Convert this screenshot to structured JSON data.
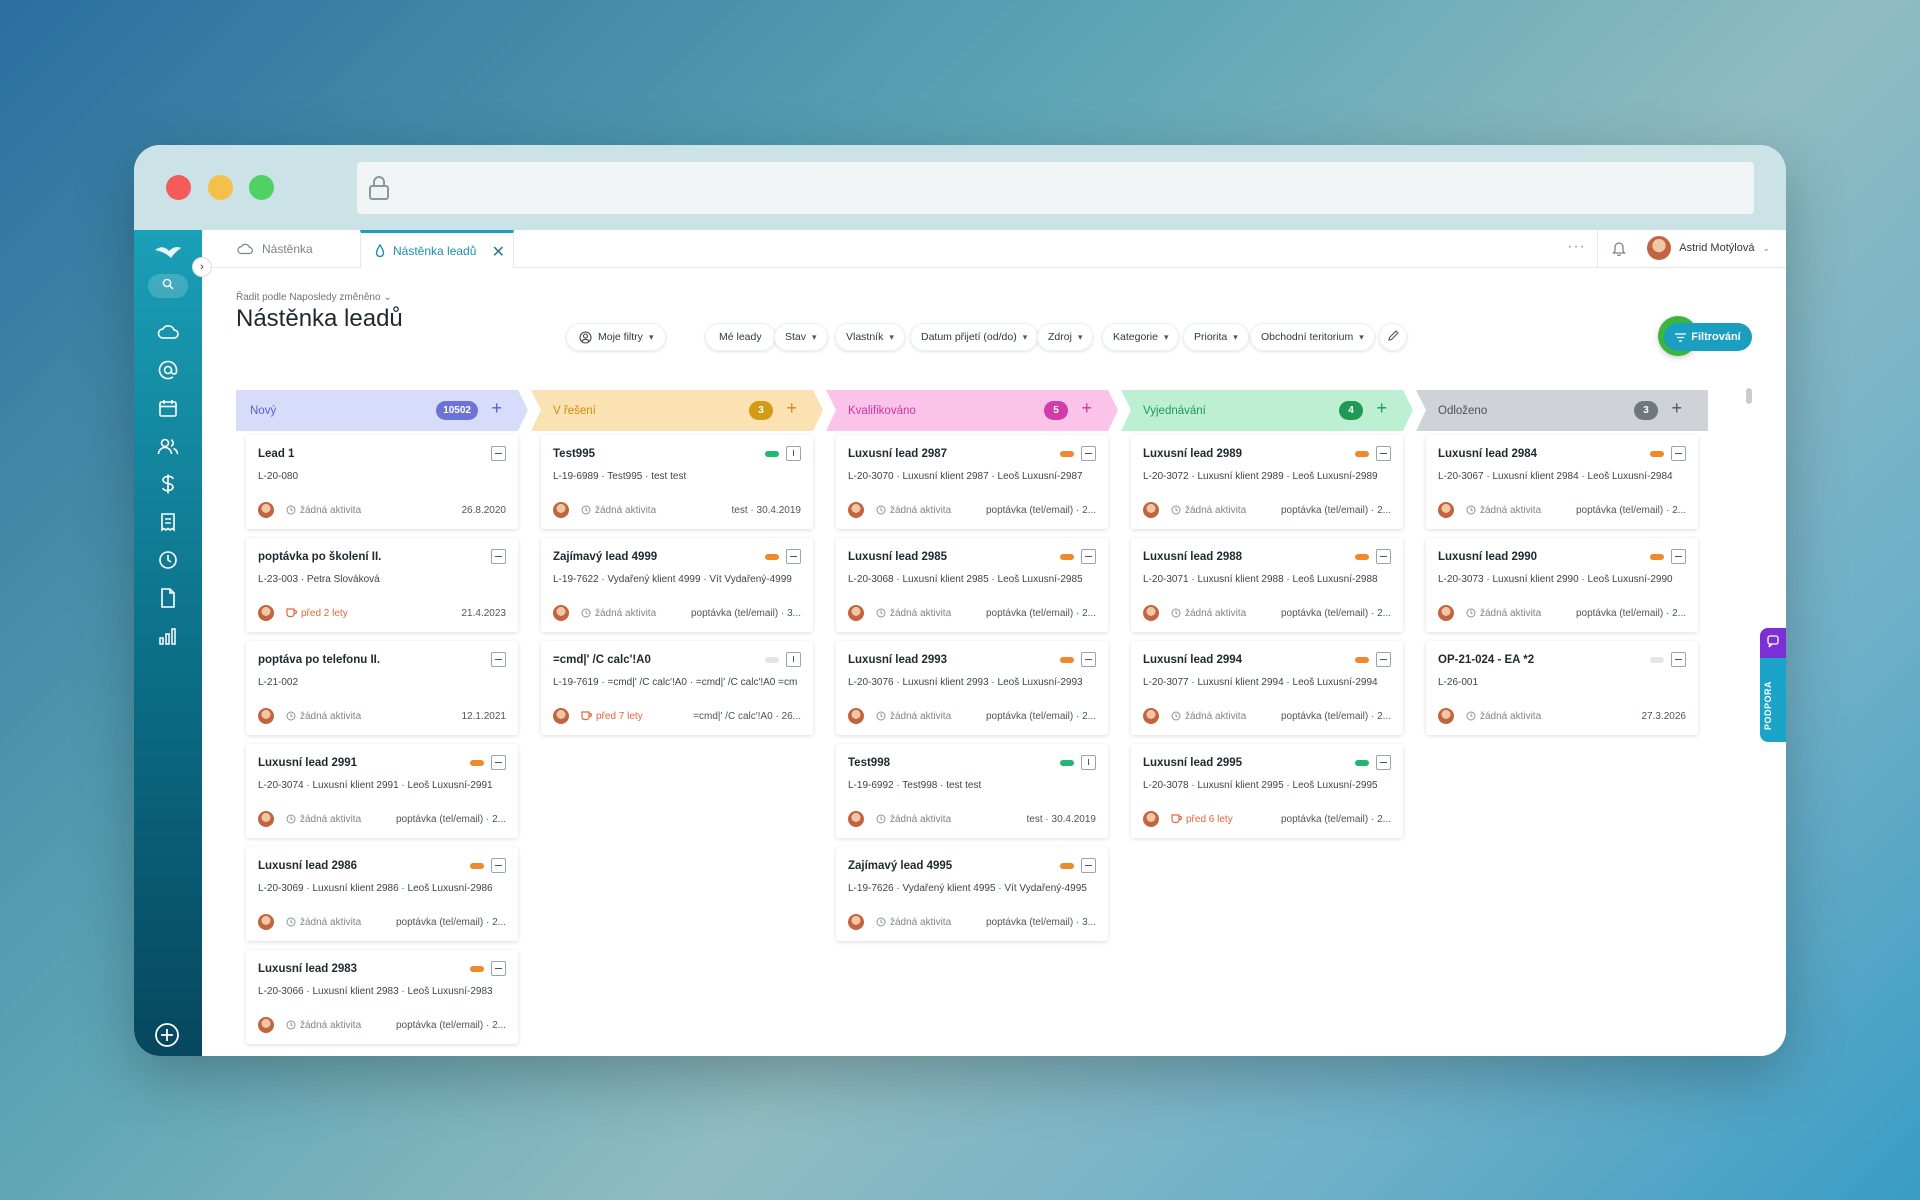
{
  "tabs": [
    {
      "label": "Nástěnka"
    },
    {
      "label": "Nástěnka leadů"
    }
  ],
  "user": {
    "name": "Astrid Motýlová"
  },
  "header": {
    "sort_label": "Řadit podle Naposledy změněno",
    "title": "Nástěnka leadů",
    "my_filters": "Moje filtry",
    "filters": [
      "Mé leady",
      "Stav",
      "Vlastník",
      "Datum přijetí (od/do)",
      "Zdroj",
      "Kategorie",
      "Priorita",
      "Obchodní teritorium"
    ],
    "add_label": "+",
    "filter_button": "Filtrování"
  },
  "support": {
    "label": "PODPORA"
  },
  "colors": {
    "accent": "#1a9fc0",
    "add_green": "#3bb53b",
    "priority_orange": "#ee8a2e",
    "priority_green": "#22b573"
  },
  "columns": [
    {
      "title": "Nový",
      "count": "10502",
      "bg": "#d8dcfb",
      "color": "#5560c8",
      "count_bg": "#6b74d6",
      "cards": [
        {
          "title": "Lead 1",
          "sub": "L-20-080",
          "activity": "žádná aktivita",
          "warn": false,
          "meta": "26.8.2020",
          "priority": null,
          "check": "minus"
        },
        {
          "title": "poptávka po školení II.",
          "sub": "L-23-003 · Petra Slováková",
          "activity": "před 2 lety",
          "warn": true,
          "meta": "21.4.2023",
          "priority": null,
          "check": "minus"
        },
        {
          "title": "poptáva po telefonu II.",
          "sub": "L-21-002",
          "activity": "žádná aktivita",
          "warn": false,
          "meta": "12.1.2021",
          "priority": null,
          "check": "minus"
        },
        {
          "title": "Luxusní lead 2991",
          "sub": "L-20-3074 · Luxusní klient 2991 · Leoš Luxusní-2991",
          "activity": "žádná aktivita",
          "warn": false,
          "meta": "poptávka (tel/email) · 2...",
          "priority": "orange",
          "check": "minus"
        },
        {
          "title": "Luxusní lead 2986",
          "sub": "L-20-3069 · Luxusní klient 2986 · Leoš Luxusní-2986",
          "activity": "žádná aktivita",
          "warn": false,
          "meta": "poptávka (tel/email) · 2...",
          "priority": "orange",
          "check": "minus"
        },
        {
          "title": "Luxusní lead 2983",
          "sub": "L-20-3066 · Luxusní klient 2983 · Leoš Luxusní-2983",
          "activity": "žádná aktivita",
          "warn": false,
          "meta": "poptávka (tel/email) · 2...",
          "priority": "orange",
          "check": "minus"
        }
      ]
    },
    {
      "title": "V řešení",
      "count": "3",
      "bg": "#fbe2b2",
      "color": "#d08a14",
      "count_bg": "#d39a16",
      "cards": [
        {
          "title": "Test995",
          "sub": "L-19-6989 · Test995 · test test",
          "activity": "žádná aktivita",
          "warn": false,
          "meta": "test · 30.4.2019",
          "priority": "green",
          "check": "bang"
        },
        {
          "title": "Zajímavý lead 4999",
          "sub": "L-19-7622 · Vydařený klient 4999 · Vít Vydařený-4999",
          "activity": "žádná aktivita",
          "warn": false,
          "meta": "poptávka (tel/email) · 3...",
          "priority": "orange",
          "check": "minus"
        },
        {
          "title": "=cmd|' /C calc'!A0",
          "sub": "L-19-7619 · =cmd|' /C calc'!A0 · =cmd|' /C calc'!A0 =cm",
          "activity": "před 7 lety",
          "warn": true,
          "meta": "=cmd|' /C calc'!A0 · 26...",
          "priority": "gray",
          "check": "bang"
        }
      ]
    },
    {
      "title": "Kvalifikováno",
      "count": "5",
      "bg": "#fbc3ea",
      "color": "#c9379c",
      "count_bg": "#d23ca7",
      "cards": [
        {
          "title": "Luxusní lead 2987",
          "sub": "L-20-3070 · Luxusní klient 2987 · Leoš Luxusní-2987",
          "activity": "žádná aktivita",
          "warn": false,
          "meta": "poptávka (tel/email) · 2...",
          "priority": "orange",
          "check": "minus"
        },
        {
          "title": "Luxusní lead 2985",
          "sub": "L-20-3068 · Luxusní klient 2985 · Leoš Luxusní-2985",
          "activity": "žádná aktivita",
          "warn": false,
          "meta": "poptávka (tel/email) · 2...",
          "priority": "orange",
          "check": "minus"
        },
        {
          "title": "Luxusní lead 2993",
          "sub": "L-20-3076 · Luxusní klient 2993 · Leoš Luxusní-2993",
          "activity": "žádná aktivita",
          "warn": false,
          "meta": "poptávka (tel/email) · 2...",
          "priority": "orange",
          "check": "minus"
        },
        {
          "title": "Test998",
          "sub": "L-19-6992 · Test998 · test test",
          "activity": "žádná aktivita",
          "warn": false,
          "meta": "test · 30.4.2019",
          "priority": "green",
          "check": "bang"
        },
        {
          "title": "Zajímavý lead 4995",
          "sub": "L-19-7626 · Vydařený klient 4995 · Vít Vydařený-4995",
          "activity": "žádná aktivita",
          "warn": false,
          "meta": "poptávka (tel/email) · 3...",
          "priority": "orange",
          "check": "minus"
        }
      ]
    },
    {
      "title": "Vyjednávání",
      "count": "4",
      "bg": "#bdf0d2",
      "color": "#1c9a55",
      "count_bg": "#1f9a55",
      "cards": [
        {
          "title": "Luxusní lead 2989",
          "sub": "L-20-3072 · Luxusní klient 2989 · Leoš Luxusní-2989",
          "activity": "žádná aktivita",
          "warn": false,
          "meta": "poptávka (tel/email) · 2...",
          "priority": "orange",
          "check": "minus"
        },
        {
          "title": "Luxusní lead 2988",
          "sub": "L-20-3071 · Luxusní klient 2988 · Leoš Luxusní-2988",
          "activity": "žádná aktivita",
          "warn": false,
          "meta": "poptávka (tel/email) · 2...",
          "priority": "orange",
          "check": "minus"
        },
        {
          "title": "Luxusní lead 2994",
          "sub": "L-20-3077 · Luxusní klient 2994 · Leoš Luxusní-2994",
          "activity": "žádná aktivita",
          "warn": false,
          "meta": "poptávka (tel/email) · 2...",
          "priority": "orange",
          "check": "minus"
        },
        {
          "title": "Luxusní lead 2995",
          "sub": "L-20-3078 · Luxusní klient 2995 · Leoš Luxusní-2995",
          "activity": "před 6 lety",
          "warn": true,
          "meta": "poptávka (tel/email) · 2...",
          "priority": "green",
          "check": "minus"
        }
      ]
    },
    {
      "title": "Odloženo",
      "count": "3",
      "bg": "#cfd2d6",
      "color": "#4c5359",
      "count_bg": "#6f767c",
      "cards": [
        {
          "title": "Luxusní lead 2984",
          "sub": "L-20-3067 · Luxusní klient 2984 · Leoš Luxusní-2984",
          "activity": "žádná aktivita",
          "warn": false,
          "meta": "poptávka (tel/email) · 2...",
          "priority": "orange",
          "check": "minus"
        },
        {
          "title": "Luxusní lead 2990",
          "sub": "L-20-3073 · Luxusní klient 2990 · Leoš Luxusní-2990",
          "activity": "žádná aktivita",
          "warn": false,
          "meta": "poptávka (tel/email) · 2...",
          "priority": "orange",
          "check": "minus"
        },
        {
          "title": "OP-21-024 - EA *2",
          "sub": "L-26-001",
          "activity": "žádná aktivita",
          "warn": false,
          "meta": "27.3.2026",
          "priority": "gray",
          "check": "minus"
        }
      ]
    }
  ]
}
